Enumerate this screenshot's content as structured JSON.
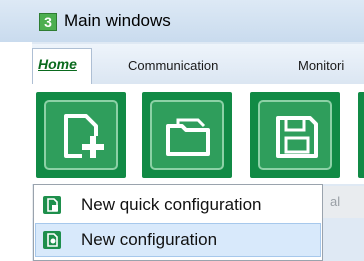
{
  "window": {
    "title": "Main windows",
    "app_icon_glyph": "3"
  },
  "tabs": [
    {
      "label": "Home",
      "active": true
    },
    {
      "label": "Communication",
      "active": false
    },
    {
      "label": "Monitori",
      "active": false
    }
  ],
  "toolbar": {
    "buttons": [
      {
        "name": "new-document-icon"
      },
      {
        "name": "open-folder-icon"
      },
      {
        "name": "save-disk-icon"
      }
    ],
    "partial_label": "al"
  },
  "dropdown": {
    "items": [
      {
        "label": "New quick configuration",
        "icon": "quick-config-icon"
      },
      {
        "label": "New configuration",
        "icon": "config-icon",
        "highlighted": true
      }
    ]
  },
  "colors": {
    "brand_green": "#118a45",
    "tab_active_text": "#0a6a1e",
    "highlight": "#d8e9fb"
  }
}
